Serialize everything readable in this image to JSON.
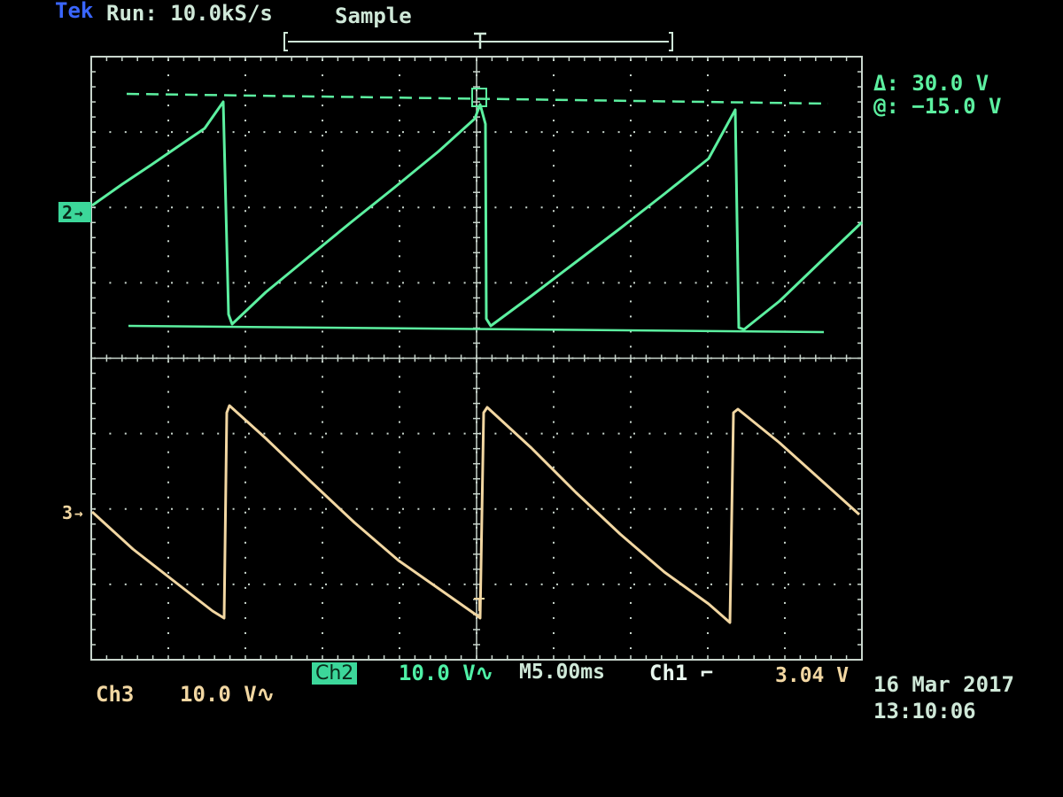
{
  "header": {
    "brand": "Tek",
    "run_status": "Run: 10.0kS/s",
    "acquisition_mode": "Sample"
  },
  "cursor_readout": {
    "delta": "Δ: 30.0 V",
    "at": "@: −15.0 V"
  },
  "channels": {
    "ch2": {
      "marker": "2",
      "badge": "Ch2",
      "scale": "10.0 V∿",
      "color": "#5cf0a0"
    },
    "ch3": {
      "marker": "3",
      "label": "Ch3",
      "scale": "10.0 V∿",
      "color": "#f2d7a2"
    }
  },
  "horizontal": {
    "timebase": "M5.00ms"
  },
  "trigger": {
    "source": "Ch1 ⌐",
    "level": "3.04 V"
  },
  "timestamp": {
    "date": "16 Mar 2017",
    "time": "13:10:06"
  },
  "colors": {
    "background": "#000000",
    "graticule": "#c9d6cd",
    "ch2_trace": "#5cf0a0",
    "ch3_trace": "#f2d7a2"
  }
}
